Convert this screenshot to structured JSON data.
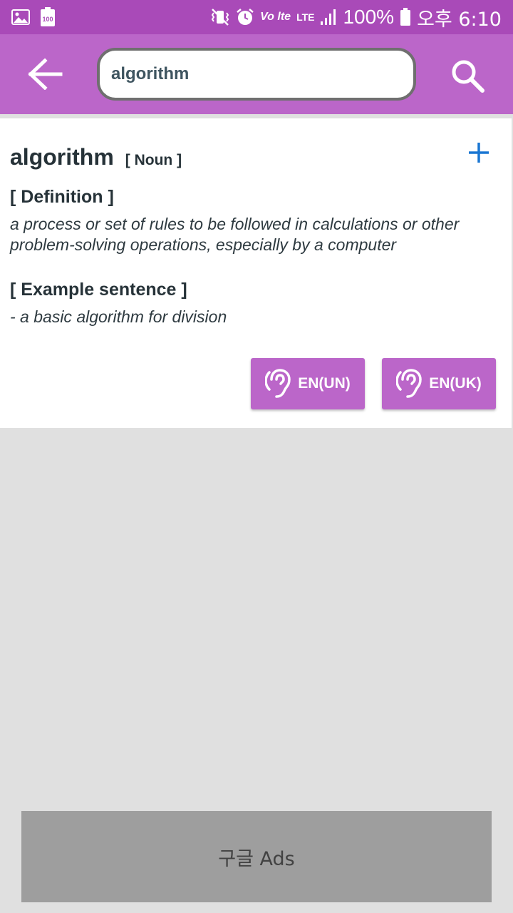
{
  "status_bar": {
    "battery_badge": "100",
    "volte_label": "Vo lte",
    "lte_label": "LTE",
    "battery_percent": "100%",
    "time": "오후 6:10"
  },
  "search": {
    "value": "algorithm",
    "placeholder": ""
  },
  "entry": {
    "word": "algorithm",
    "part_of_speech": "[ Noun ]",
    "definition_heading": "[ Definition ]",
    "definition_text": "a process or set of rules to be followed in calculations or other problem-solving operations, especially by a computer",
    "example_heading": "[ Example sentence ]",
    "example_text": "- a basic algorithm for division"
  },
  "tts_buttons": [
    {
      "label": "EN(UN)",
      "icon": "hearing-icon"
    },
    {
      "label": "EN(UK)",
      "icon": "hearing-icon"
    }
  ],
  "ads": {
    "label": "구글 Ads"
  },
  "colors": {
    "status_bar": "#a94ab8",
    "app_bar": "#bb66c9",
    "accent_blue": "#1976d2",
    "background": "#e0e0e0",
    "ads_background": "#9e9e9e"
  }
}
